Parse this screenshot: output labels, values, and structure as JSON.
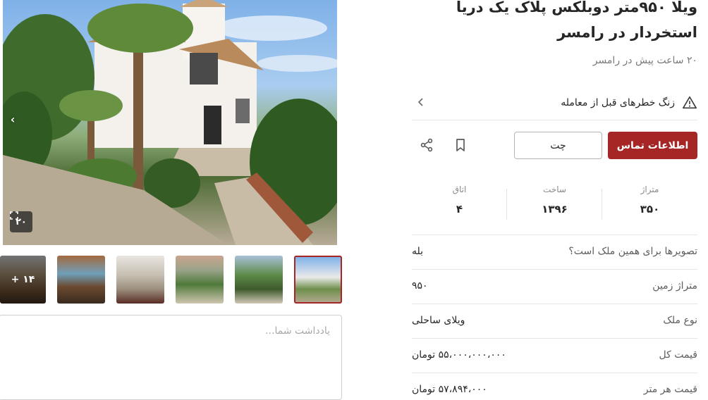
{
  "gallery": {
    "photo_count": "۲۰",
    "more_thumbs": "+ ۱۴",
    "expand_icon": "expand-icon",
    "prev_icon": "chevron-left-icon"
  },
  "notes": {
    "placeholder": "یادداشت شما..."
  },
  "listing": {
    "title": "ویلا ۹۵۰متر دوبلکس پلاک یک دریا استخردار در رامسر",
    "subtitle": "۲۰ ساعت پیش در رامسر",
    "warning": "زنگ خطرهای قبل از معامله",
    "warning_icon": "warning-triangle-icon"
  },
  "actions": {
    "contact_label": "اطلاعات تماس",
    "chat_label": "چت",
    "bookmark_icon": "bookmark-icon",
    "share_icon": "share-icon",
    "accent": "#a62626"
  },
  "stats": [
    {
      "label": "متراژ",
      "value": "۳۵۰"
    },
    {
      "label": "ساخت",
      "value": "۱۳۹۶"
    },
    {
      "label": "اتاق",
      "value": "۴"
    }
  ],
  "details": [
    {
      "key": "تصویرها برای همین ملک است؟",
      "value": "بله"
    },
    {
      "key": "متراژ زمین",
      "value": "۹۵۰"
    },
    {
      "key": "نوع ملک",
      "value": "ویلای ساحلی"
    },
    {
      "key": "قیمت کل",
      "value": "۵۵،۰۰۰،۰۰۰،۰۰۰ تومان"
    },
    {
      "key": "قیمت هر متر",
      "value": "۵۷،۸۹۴،۰۰۰ تومان"
    }
  ]
}
